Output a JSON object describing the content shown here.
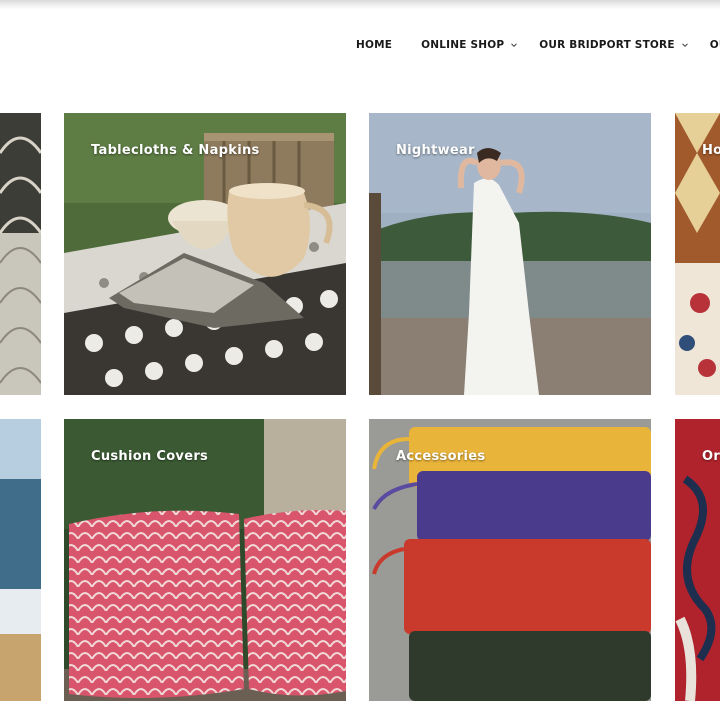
{
  "nav": {
    "home": "HOME",
    "online_shop": "ONLINE SHOP",
    "bridport_store": "OUR BRIDPORT STORE",
    "partial": "OU"
  },
  "icons": [
    "chevron-down-icon"
  ],
  "tiles": [
    {
      "label": ""
    },
    {
      "label": "Tablecloths & Napkins"
    },
    {
      "label": "Nightwear"
    },
    {
      "label": "Ho"
    },
    {
      "label": ""
    },
    {
      "label": "Cushion Covers"
    },
    {
      "label": "Accessories"
    },
    {
      "label": "Or"
    }
  ],
  "colors": {
    "nav_text": "#1a1a1a",
    "label_text": "#ffffff",
    "cushion_pink": "#d9556b",
    "accessory_yellow": "#e9b43a",
    "accessory_purple": "#4b3b8c",
    "accessory_red": "#c93a2c",
    "accessory_green": "#2f3a2d"
  }
}
